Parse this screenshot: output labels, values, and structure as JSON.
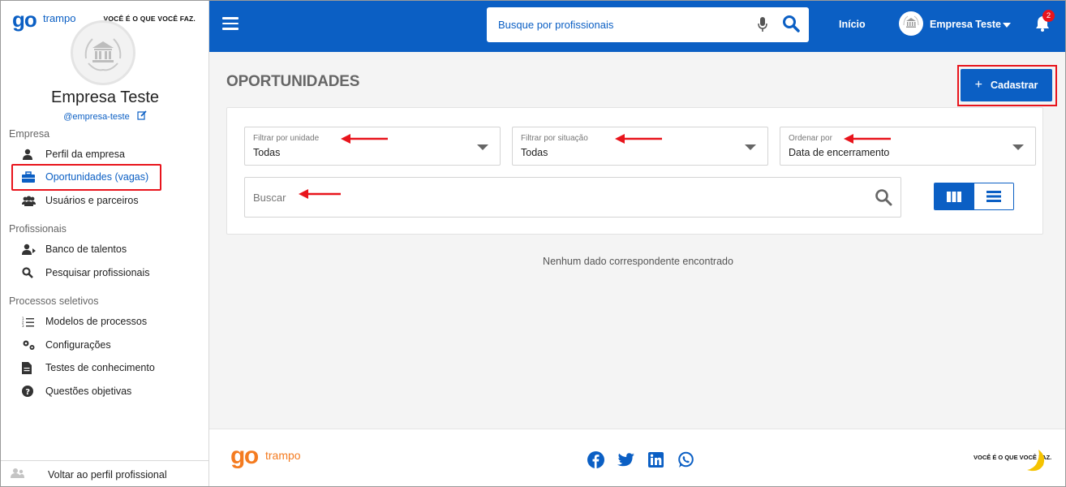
{
  "brand": {
    "go": "go",
    "trampo": "trampo",
    "slogan": "VOCÊ É O QUE VOCÊ FAZ."
  },
  "profile": {
    "name": "Empresa Teste",
    "handle": "@empresa-teste"
  },
  "sidebar": {
    "sections": [
      {
        "title": "Empresa"
      },
      {
        "title": "Profissionais"
      },
      {
        "title": "Processos seletivos"
      }
    ],
    "items": [
      {
        "label": "Perfil da empresa",
        "icon": "user-tie-icon"
      },
      {
        "label": "Oportunidades (vagas)",
        "icon": "briefcase-icon",
        "active": true
      },
      {
        "label": "Usuários e parceiros",
        "icon": "users-icon"
      },
      {
        "label": "Banco de talentos",
        "icon": "user-plus-icon"
      },
      {
        "label": "Pesquisar profissionais",
        "icon": "search-icon"
      },
      {
        "label": "Modelos de processos",
        "icon": "list-icon"
      },
      {
        "label": "Configurações",
        "icon": "gears-icon"
      },
      {
        "label": "Testes de conhecimento",
        "icon": "file-icon"
      },
      {
        "label": "Questões objetivas",
        "icon": "question-icon"
      }
    ],
    "back_label": "Voltar ao perfil profissional"
  },
  "header": {
    "search_placeholder": "Busque por profissionais",
    "home_label": "Início",
    "user_label": "Empresa Teste",
    "notification_count": "2"
  },
  "main": {
    "title": "OPORTUNIDADES",
    "add_button_label": "Cadastrar",
    "filters": [
      {
        "label": "Filtrar por unidade",
        "value": "Todas"
      },
      {
        "label": "Filtrar por situação",
        "value": "Todas"
      },
      {
        "label": "Ordenar por",
        "value": "Data de encerramento"
      }
    ],
    "search_placeholder": "Buscar",
    "empty_message": "Nenhum dado correspondente encontrado"
  },
  "footer": {
    "slogan": "VOCÊ É O QUE VOCÊ FAZ.",
    "socials": [
      "facebook-icon",
      "twitter-icon",
      "linkedin-icon",
      "whatsapp-icon"
    ]
  },
  "colors": {
    "primary": "#0b5fc4",
    "accent_orange": "#f47b20",
    "highlight_red": "#e8141c"
  }
}
